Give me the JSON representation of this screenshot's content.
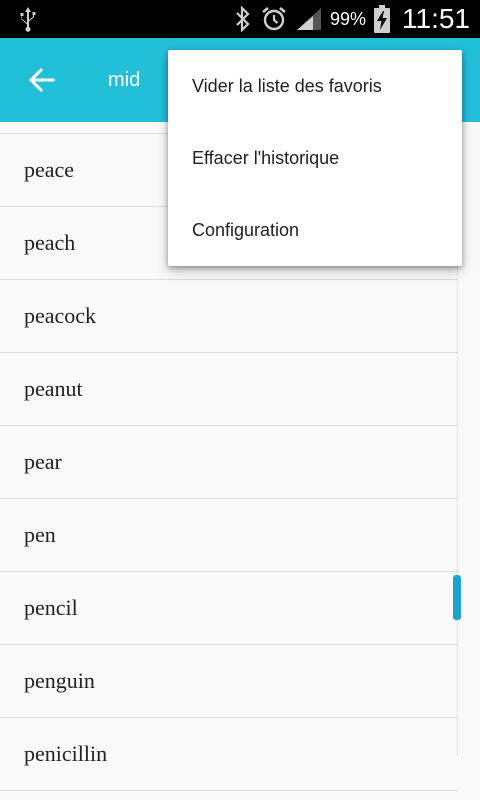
{
  "status_bar": {
    "battery_percent": "99%",
    "time": "11:51"
  },
  "toolbar": {
    "search_value": "mid"
  },
  "word_list": [
    "peace",
    "peach",
    "peacock",
    "peanut",
    "pear",
    "pen",
    "pencil",
    "penguin",
    "penicillin"
  ],
  "menu": {
    "items": [
      "Vider la liste des favoris",
      "Effacer l'historique",
      "Configuration"
    ]
  },
  "colors": {
    "toolbar": "#22bfd9",
    "scroll_thumb": "#1aa3cf"
  }
}
